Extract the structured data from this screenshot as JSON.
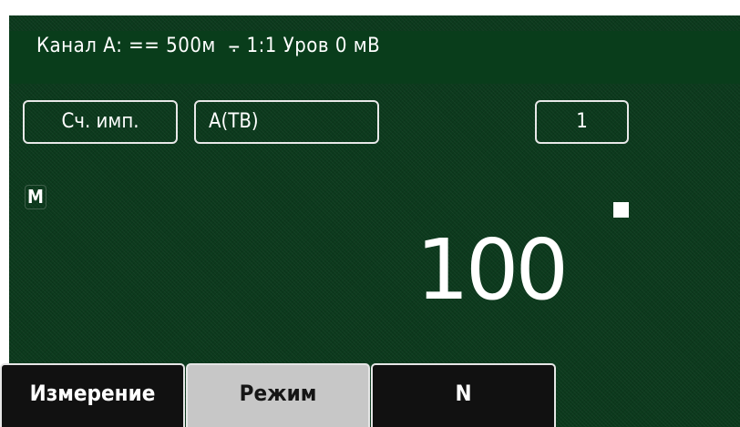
{
  "header": {
    "text": "Канал А: == 500м  ⨪ 1:1 Уров 0 мВ"
  },
  "fields": {
    "mode": "Сч. имп.",
    "channel": "A(TB)",
    "number": "1"
  },
  "marker": "M",
  "display": {
    "value": "100"
  },
  "softkeys": [
    {
      "label": "Измерение",
      "active": false
    },
    {
      "label": "Режим",
      "active": true
    },
    {
      "label": "N",
      "active": false
    }
  ],
  "colors": {
    "background": "#0c3a1d",
    "header": "#093d1b",
    "text": "#ffffff",
    "softkey_active": "#c7c7c7",
    "softkey_inactive": "#111111"
  }
}
